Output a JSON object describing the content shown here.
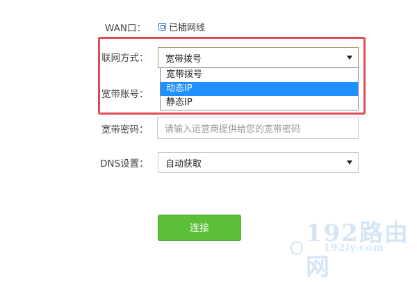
{
  "form": {
    "wan": {
      "label": "WAN口：",
      "status": "已插网线"
    },
    "connection_type": {
      "label": "联网方式：",
      "value": "宽带拨号",
      "options": [
        "宽带拨号",
        "动态IP",
        "静态IP"
      ],
      "highlighted_option": "动态IP"
    },
    "account": {
      "label": "宽带账号："
    },
    "password": {
      "label": "宽带密码：",
      "placeholder": "请输入运营商提供给您的宽带密码"
    },
    "dns": {
      "label": "DNS设置：",
      "value": "自动获取"
    },
    "connect_button": "连接"
  },
  "watermark": {
    "main": "192路由网",
    "sub": "192ly.com"
  },
  "colors": {
    "highlight_border": "#e04b51",
    "selected_option": "#1e90ff",
    "connect_button": "#5cbf3a"
  }
}
